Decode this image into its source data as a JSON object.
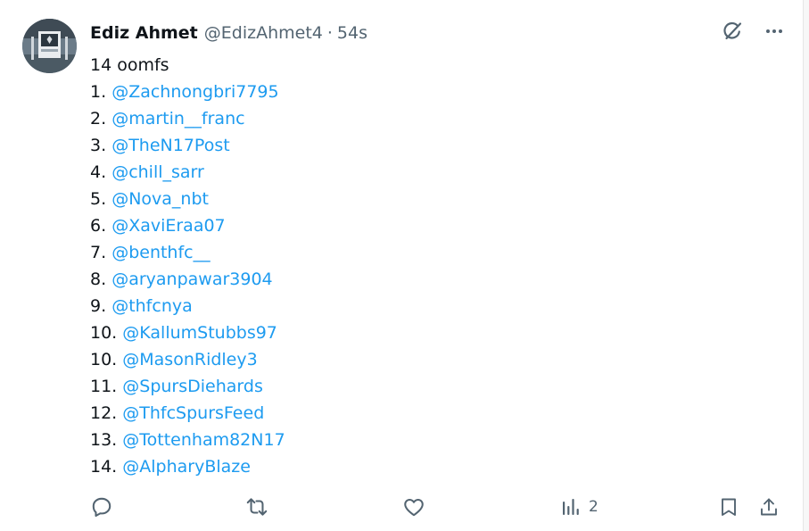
{
  "tweet": {
    "author_name": "Ediz Ahmet",
    "author_handle": "@EdizAhmet4",
    "separator": "·",
    "time": "54s",
    "intro": "14 oomfs",
    "list": [
      {
        "num": "1.",
        "mention": "@Zachnongbri7795"
      },
      {
        "num": "2.",
        "mention": "@martin__franc"
      },
      {
        "num": "3.",
        "mention": "@TheN17Post"
      },
      {
        "num": "4.",
        "mention": "@chill_sarr"
      },
      {
        "num": "5.",
        "mention": "@Nova_nbt"
      },
      {
        "num": "6.",
        "mention": "@XaviEraa07"
      },
      {
        "num": "7.",
        "mention": "@benthfc__"
      },
      {
        "num": "8.",
        "mention": "@aryanpawar3904"
      },
      {
        "num": "9.",
        "mention": "@thfcnya"
      },
      {
        "num": "10.",
        "mention": "@KallumStubbs97"
      },
      {
        "num": "10.",
        "mention": "@MasonRidley3"
      },
      {
        "num": "11.",
        "mention": "@SpursDiehards"
      },
      {
        "num": "12.",
        "mention": "@ThfcSpursFeed"
      },
      {
        "num": "13.",
        "mention": "@Tottenham82N17"
      },
      {
        "num": "14.",
        "mention": "@AlpharyBlaze"
      }
    ],
    "views_count": "2"
  },
  "icons": {
    "grok": "grok-icon",
    "more": "more-icon",
    "reply": "reply-icon",
    "retweet": "retweet-icon",
    "like": "like-icon",
    "views": "views-icon",
    "bookmark": "bookmark-icon",
    "share": "share-icon"
  },
  "colors": {
    "mention": "#1d9bf0",
    "secondary_text": "#536471",
    "primary_text": "#0f1419"
  }
}
